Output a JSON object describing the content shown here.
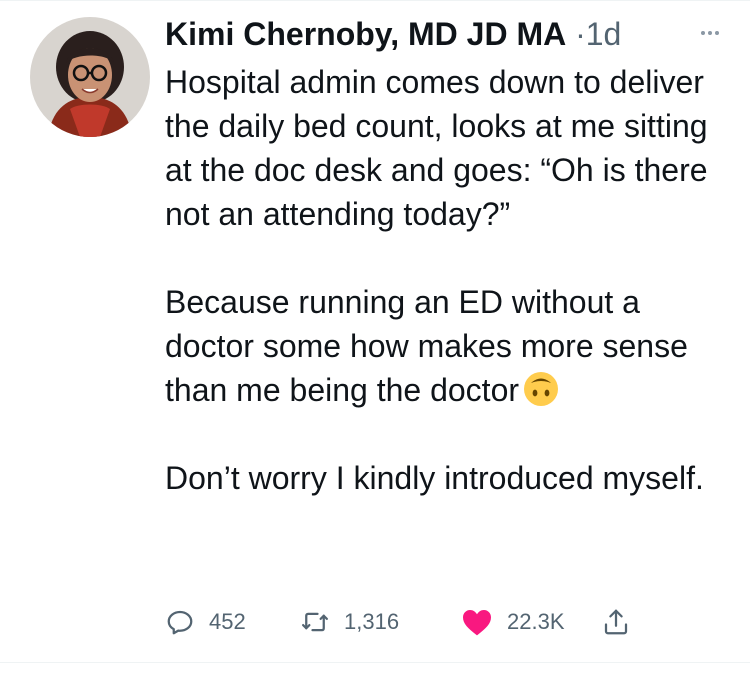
{
  "tweet": {
    "author": {
      "display_name": "Kimi Chernoby, MD JD MA",
      "separator": "·",
      "timestamp": "1d"
    },
    "paragraphs": [
      "Hospital admin comes down to deliver the daily bed count, looks at me sitting at the doc desk and goes: “Oh is there not an attending today?”",
      "Because running an ED without a doctor some how makes more sense than me being the doctor",
      "Don’t worry I kindly introduced myself."
    ],
    "emoji": "upside-down-face",
    "actions": {
      "reply_count": "452",
      "retweet_count": "1,316",
      "like_count": "22.3K",
      "liked": true
    }
  },
  "colors": {
    "text_primary": "#0f1419",
    "text_secondary": "#536471",
    "like": "#f91880",
    "emoji": "#ffcc4d"
  },
  "icons": [
    "more-icon",
    "reply-icon",
    "retweet-icon",
    "like-icon",
    "share-icon"
  ]
}
